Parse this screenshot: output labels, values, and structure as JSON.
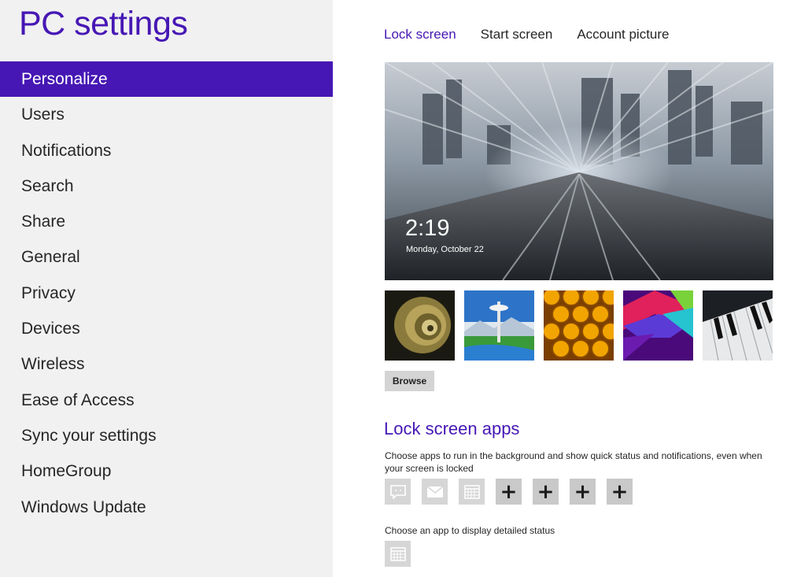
{
  "app": {
    "title": "PC settings"
  },
  "sidebar": {
    "items": [
      {
        "label": "Personalize",
        "active": true
      },
      {
        "label": "Users"
      },
      {
        "label": "Notifications"
      },
      {
        "label": "Search"
      },
      {
        "label": "Share"
      },
      {
        "label": "General"
      },
      {
        "label": "Privacy"
      },
      {
        "label": "Devices"
      },
      {
        "label": "Wireless"
      },
      {
        "label": "Ease of Access"
      },
      {
        "label": "Sync your settings"
      },
      {
        "label": "HomeGroup"
      },
      {
        "label": "Windows Update"
      }
    ]
  },
  "tabs": [
    {
      "label": "Lock screen",
      "active": true
    },
    {
      "label": "Start screen"
    },
    {
      "label": "Account picture"
    }
  ],
  "preview": {
    "time": "2:19",
    "date": "Monday, October 22"
  },
  "thumbnails": [
    {
      "name": "nautilus-shell"
    },
    {
      "name": "space-needle"
    },
    {
      "name": "honeycomb"
    },
    {
      "name": "geometric-color"
    },
    {
      "name": "piano-keys"
    }
  ],
  "browse_label": "Browse",
  "lock_apps": {
    "title": "Lock screen apps",
    "description": "Choose apps to run in the background and show quick status and notifications, even when your screen is locked",
    "slots": [
      {
        "type": "app",
        "icon": "messaging-icon"
      },
      {
        "type": "app",
        "icon": "mail-icon"
      },
      {
        "type": "app",
        "icon": "calendar-icon"
      },
      {
        "type": "empty",
        "glyph": "+"
      },
      {
        "type": "empty",
        "glyph": "+"
      },
      {
        "type": "empty",
        "glyph": "+"
      },
      {
        "type": "empty",
        "glyph": "+"
      }
    ],
    "detail_description": "Choose an app to display detailed status",
    "detail_app": {
      "icon": "calendar-icon"
    }
  },
  "colors": {
    "accent": "#4617b4",
    "sidebar_bg": "#f1f1f1",
    "tile_bg": "#d6d6d6"
  }
}
